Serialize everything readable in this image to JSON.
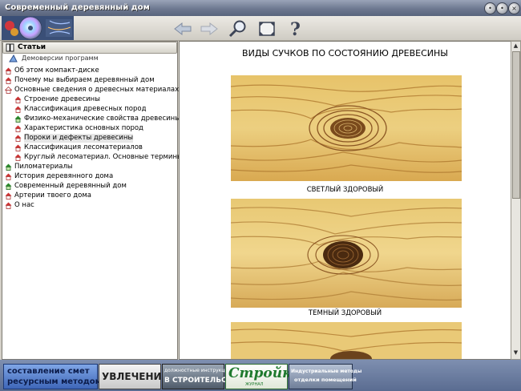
{
  "window": {
    "title": "Современный деревянный дом"
  },
  "toolbar": {
    "icons": [
      "back-arrow-icon",
      "forward-arrow-icon",
      "magnifier-icon",
      "fullscreen-icon",
      "help-icon"
    ]
  },
  "sidebar": {
    "tab_label": "Статьи",
    "subtab_label": "Демоверсии программ",
    "items": [
      {
        "label": "Об этом компакт-диске",
        "level": 0
      },
      {
        "label": "Почему мы выбираем деревянный дом",
        "level": 0
      },
      {
        "label": "Основные сведения о древесных материалах",
        "level": 0
      },
      {
        "label": "Строение древесины",
        "level": 1
      },
      {
        "label": "Классификация древесных пород",
        "level": 1
      },
      {
        "label": "Физико-механические свойства древесины",
        "level": 1
      },
      {
        "label": "Характеристика основных пород",
        "level": 1
      },
      {
        "label": "Пороки и дефекты древесины",
        "level": 1,
        "selected": true
      },
      {
        "label": "Классификация лесоматериалов",
        "level": 1
      },
      {
        "label": "Круглый лесоматериал. Основные термины",
        "level": 1
      },
      {
        "label": "Пиломатериалы",
        "level": 0
      },
      {
        "label": "История деревянного дома",
        "level": 0
      },
      {
        "label": "Современный деревянный дом",
        "level": 0
      },
      {
        "label": "Артерии твоего дома",
        "level": 0
      },
      {
        "label": "О нас",
        "level": 0
      }
    ]
  },
  "content": {
    "heading": "ВИДЫ СУЧКОВ ПО СОСТОЯНИЮ ДРЕВЕСИНЫ",
    "captions": [
      "СВЕТЛЫЙ ЗДОРОВЫЙ",
      "ТЕМНЫЙ ЗДОРОВЫЙ"
    ]
  },
  "banners": {
    "b1": {
      "line1": "составление смет",
      "line2": "ресурсным методом"
    },
    "b2": {
      "text": "УВЛЕЧЕНИЯ"
    },
    "b3": {
      "line1": "должностные инструкции",
      "line2": "В СТРОИТЕЛЬСТВЕ"
    },
    "b4": {
      "text": "Стройка",
      "sub": "ЖУРНАЛ"
    },
    "b5": {
      "line1": "Индустриальные методы",
      "line2": "отделки помещений"
    }
  },
  "colors": {
    "titlebar": "#6d7890",
    "wood_light": "#e8c873",
    "wood_dark": "#b07a30",
    "knot_dark": "#4a2a10",
    "banner_bar": "#6a7ca0"
  }
}
